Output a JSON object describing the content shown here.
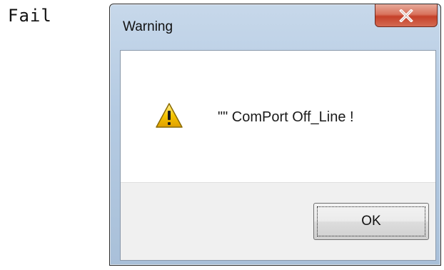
{
  "background_label": "Fail",
  "dialog": {
    "title": "Warning",
    "close_icon": "close-x-icon",
    "message_icon": "warning-triangle-icon",
    "message": "\"\" ComPort Off_Line !",
    "ok_label": "OK"
  },
  "colors": {
    "close_button": "#c5412a",
    "warning_yellow": "#f5c400",
    "button_bar": "#f0f0f0"
  }
}
